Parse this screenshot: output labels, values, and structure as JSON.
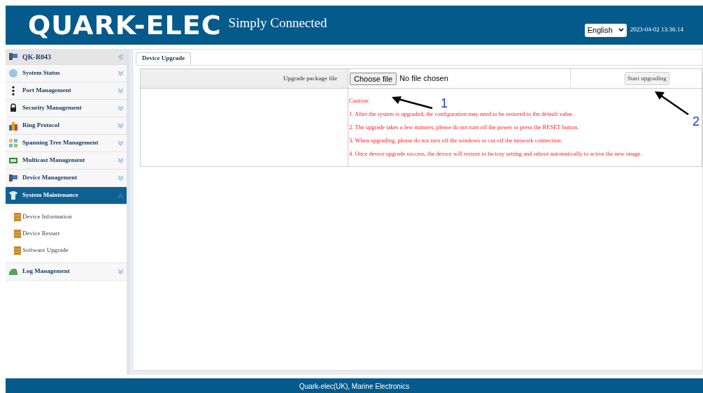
{
  "header": {
    "logo": "QUARK-ELEC",
    "tagline": "Simply Connected",
    "language": "English",
    "datetime": "2023-04-02 13:36:14"
  },
  "sidebar": {
    "title": "QK-R043",
    "items": [
      {
        "label": "System Status",
        "expanded": false
      },
      {
        "label": "Port Management",
        "expanded": false
      },
      {
        "label": "Security Management",
        "expanded": false
      },
      {
        "label": "Ring Protocol",
        "expanded": false
      },
      {
        "label": "Spanning Tree Management",
        "expanded": false
      },
      {
        "label": "Multicast Management",
        "expanded": false
      },
      {
        "label": "Device Management",
        "expanded": false
      },
      {
        "label": "System Maintenance",
        "expanded": true,
        "children": [
          {
            "label": "Device Information"
          },
          {
            "label": "Device Restart"
          },
          {
            "label": "Software Upgrade"
          }
        ]
      },
      {
        "label": "Log Management",
        "expanded": false
      }
    ]
  },
  "tabs": [
    {
      "label": "Device Upgrade",
      "selected": true
    }
  ],
  "form": {
    "field_label": "Upgrade package file",
    "choose_button": "Choose file",
    "file_status": "No file chosen",
    "start_button": "Start upgrading",
    "caution": [
      "Caution:",
      "1. After the system is upgraded, the configuration may need to be restored to the default value.",
      "2. The upgrade takes a few minutes, please do not turn off the power or press the RESET button.",
      "3. When upgrading, please do not turn off the windows or cut off the network connection.",
      "4. Once device upgrade success, the device will restore to factory setting and reboot automatically to active the new image."
    ]
  },
  "annotations": [
    "1",
    "2"
  ],
  "footer": "Quark-elec(UK), Marine Electronics"
}
